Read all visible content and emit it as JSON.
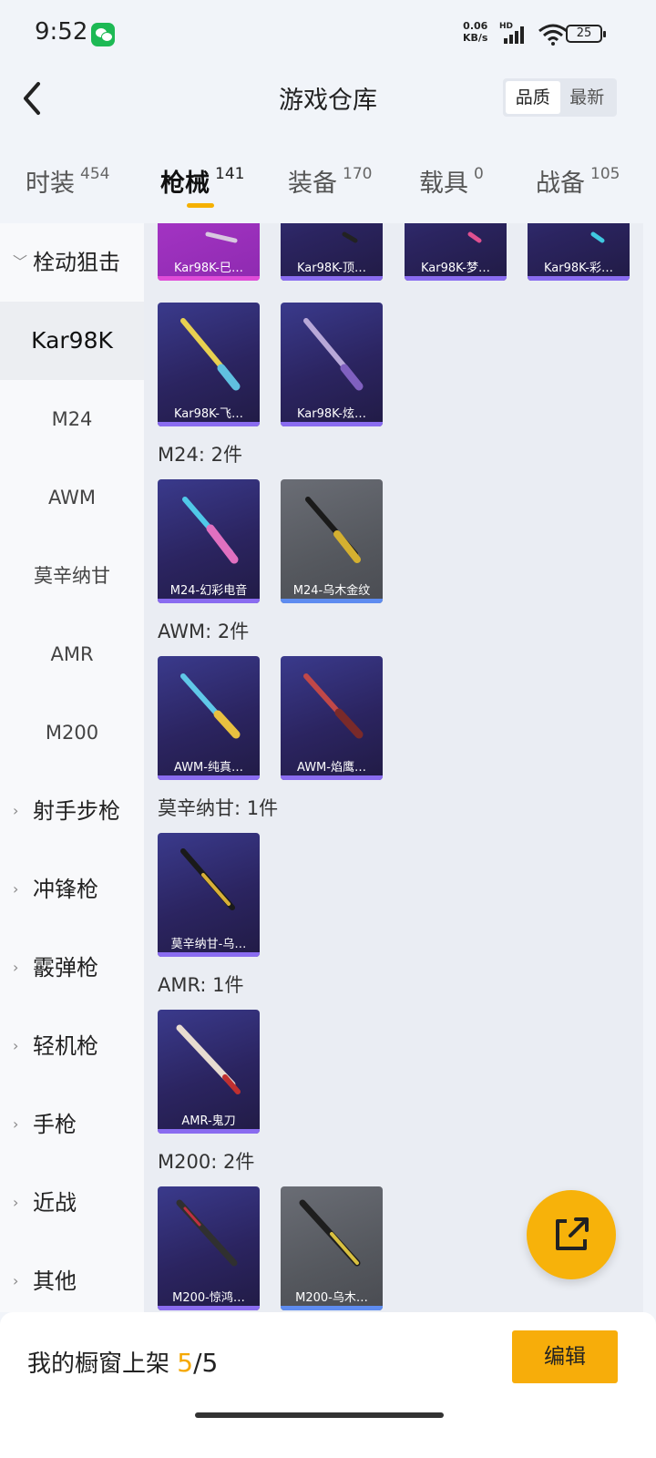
{
  "status_bar": {
    "time": "9:52",
    "net_speed_value": "0.06",
    "net_speed_unit": "KB/s",
    "network_type": "HD",
    "battery": "25"
  },
  "header": {
    "title": "游戏仓库",
    "sort_options": [
      "品质",
      "最新"
    ],
    "selected_sort": "品质"
  },
  "tabs": [
    {
      "label": "时装",
      "count": "454"
    },
    {
      "label": "枪械",
      "count": "141"
    },
    {
      "label": "装备",
      "count": "170"
    },
    {
      "label": "载具",
      "count": "0"
    },
    {
      "label": "战备",
      "count": "105"
    }
  ],
  "active_tab": "枪械",
  "sidebar": {
    "items": [
      {
        "label": "栓动狙击",
        "type": "category",
        "expanded": true
      },
      {
        "label": "Kar98K",
        "type": "sub",
        "selected": true
      },
      {
        "label": "M24",
        "type": "sub"
      },
      {
        "label": "AWM",
        "type": "sub"
      },
      {
        "label": "莫辛纳甘",
        "type": "sub"
      },
      {
        "label": "AMR",
        "type": "sub"
      },
      {
        "label": "M200",
        "type": "sub"
      },
      {
        "label": "射手步枪",
        "type": "category"
      },
      {
        "label": "冲锋枪",
        "type": "category"
      },
      {
        "label": "霰弹枪",
        "type": "category"
      },
      {
        "label": "轻机枪",
        "type": "category"
      },
      {
        "label": "手枪",
        "type": "category"
      },
      {
        "label": "近战",
        "type": "category"
      },
      {
        "label": "其他",
        "type": "category"
      }
    ]
  },
  "sections": [
    {
      "title": "",
      "items": [
        {
          "name": "Kar98K-巳…",
          "quality": "pink"
        },
        {
          "name": "Kar98K-顶…",
          "quality": "purple"
        },
        {
          "name": "Kar98K-梦…",
          "quality": "purple"
        },
        {
          "name": "Kar98K-彩…",
          "quality": "purple"
        },
        {
          "name": "Kar98K-飞…",
          "quality": "purple"
        },
        {
          "name": "Kar98K-炫…",
          "quality": "purple"
        }
      ]
    },
    {
      "title": "M24: 2件",
      "items": [
        {
          "name": "M24-幻彩电音",
          "quality": "purple"
        },
        {
          "name": "M24-乌木金纹",
          "quality": "gray"
        }
      ]
    },
    {
      "title": "AWM: 2件",
      "items": [
        {
          "name": "AWM-纯真…",
          "quality": "purple"
        },
        {
          "name": "AWM-焰鹰…",
          "quality": "purple"
        }
      ]
    },
    {
      "title": "莫辛纳甘: 1件",
      "items": [
        {
          "name": "莫辛纳甘-乌…",
          "quality": "purple"
        }
      ]
    },
    {
      "title": "AMR: 1件",
      "items": [
        {
          "name": "AMR-鬼刀",
          "quality": "purple"
        }
      ]
    },
    {
      "title": "M200: 2件",
      "items": [
        {
          "name": "M200-惊鸿…",
          "quality": "purple"
        },
        {
          "name": "M200-乌木…",
          "quality": "gray"
        }
      ]
    }
  ],
  "bottom_bar": {
    "label": "我的橱窗上架",
    "current": "5",
    "separator": "/",
    "total": "5",
    "edit_label": "编辑"
  },
  "colors": {
    "accent": "#f7ad0a",
    "purple_card": "#2b2460",
    "gray_card": "#55585e",
    "pink_card": "#a533c4"
  }
}
